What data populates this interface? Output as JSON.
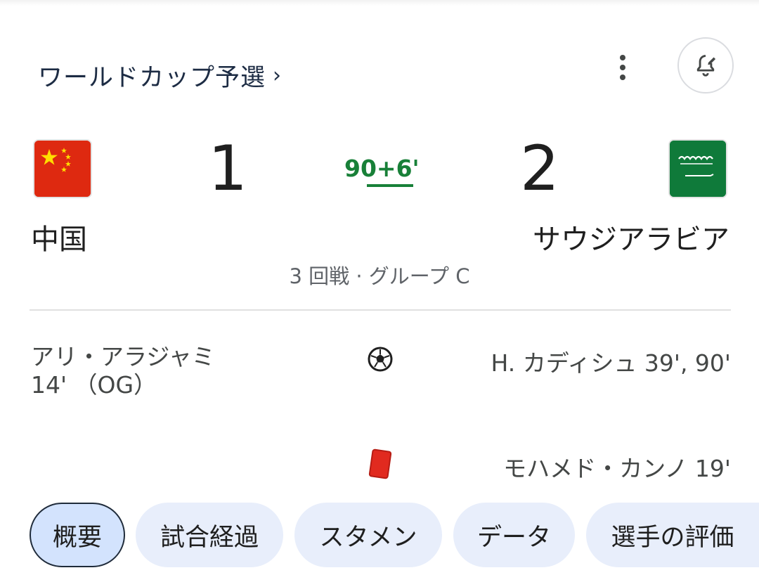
{
  "header": {
    "competition": "ワールドカップ予選",
    "chevron": "›",
    "more_icon": "more-vert-icon",
    "alert_icon": "bell-edit-icon"
  },
  "match": {
    "home": {
      "name": "中国",
      "score": "1",
      "flag": "china-flag-icon"
    },
    "away": {
      "name": "サウジアラビア",
      "score": "2",
      "flag": "saudi-arabia-flag-icon"
    },
    "clock": "90+6'",
    "round": "3 回戦 · グループ C",
    "accent_color": "#188038"
  },
  "events": {
    "goals": {
      "icon": "soccer-ball-icon",
      "home": "アリ・アラジャミ 14' （OG）",
      "away": "H. カディシュ 39', 90'"
    },
    "red_cards": {
      "icon": "red-card-icon",
      "home": "",
      "away": "モハメド・カンノ 19'"
    }
  },
  "tabs": [
    {
      "label": "概要",
      "active": true
    },
    {
      "label": "試合経過",
      "active": false
    },
    {
      "label": "スタメン",
      "active": false
    },
    {
      "label": "データ",
      "active": false
    },
    {
      "label": "選手の評価",
      "active": false
    }
  ]
}
